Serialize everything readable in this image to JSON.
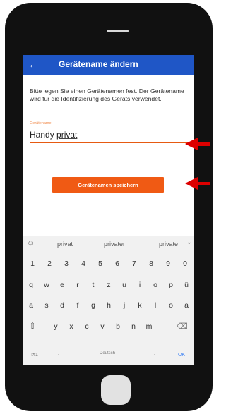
{
  "app_bar": {
    "title": "Gerätename ändern",
    "back_icon": "←"
  },
  "description": "Bitte legen Sie einen Gerätenamen fest. Der Gerätename wird für die Identifizierung des Geräts verwendet.",
  "field": {
    "label": "Gerätename",
    "value_word1": "Handy",
    "value_word2": "privat"
  },
  "save_button": {
    "label": "Gerätenamen speichern",
    "color": "#f05a14"
  },
  "keyboard": {
    "suggestion_icon": "☺",
    "suggestions": [
      "privat",
      "privater",
      "private"
    ],
    "collapse_icon": "⌄",
    "rows": [
      [
        "1",
        "2",
        "3",
        "4",
        "5",
        "6",
        "7",
        "8",
        "9",
        "0"
      ],
      [
        "q",
        "w",
        "e",
        "r",
        "t",
        "z",
        "u",
        "i",
        "o",
        "p",
        "ü"
      ],
      [
        "a",
        "s",
        "d",
        "f",
        "g",
        "h",
        "j",
        "k",
        "l",
        "ö",
        "ä"
      ]
    ],
    "shift_icon": "⇧",
    "row4": [
      "y",
      "x",
      "c",
      "v",
      "b",
      "n",
      "m"
    ],
    "backspace_icon": "⌫",
    "symbols_key": "!#1",
    "comma_key": ",",
    "space_label": "Deutsch",
    "period_key": ".",
    "ok_key": "OK"
  },
  "annotations": {
    "arrow_color": "#dd0000"
  },
  "theme": {
    "app_bar_color": "#1f56c6",
    "accent_color": "#f05a14"
  }
}
